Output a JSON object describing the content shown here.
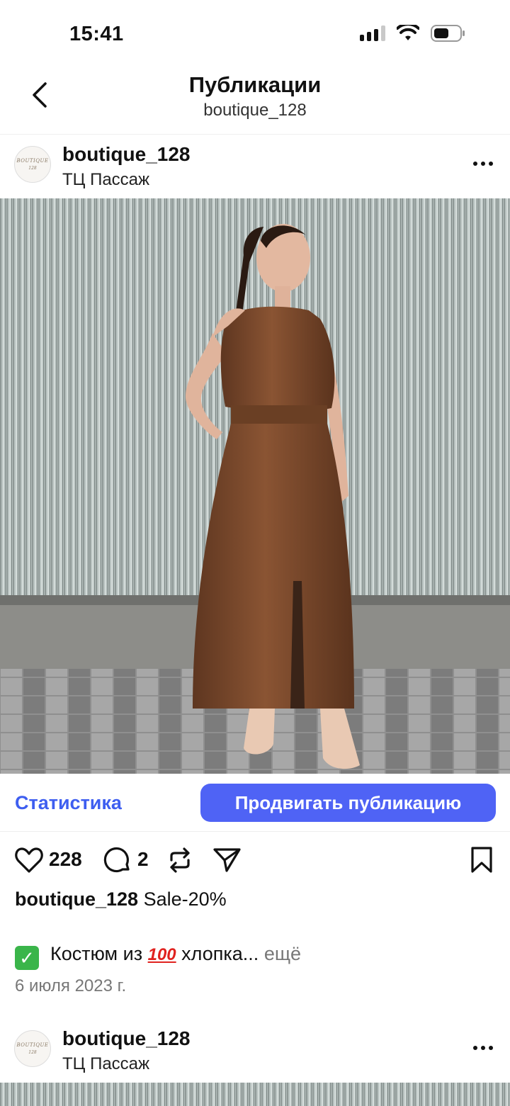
{
  "status": {
    "time": "15:41"
  },
  "nav": {
    "title": "Публикации",
    "subtitle": "boutique_128"
  },
  "post": {
    "username": "boutique_128",
    "location": "ТЦ  Пассаж",
    "avatar_line1": "BOUTIQUE",
    "avatar_line2": "128",
    "actions": {
      "stats_label": "Статистика",
      "promote_label": "Продвигать публикацию"
    },
    "likes": "228",
    "comments": "2",
    "caption_user": "boutique_128",
    "caption_text": "Sale-20%",
    "desc_check": "✓",
    "desc_text1": "Костюм  из",
    "desc_emoji": "100",
    "desc_text2": "хлопка...",
    "desc_more": "ещё",
    "date": "6 июля 2023 г."
  },
  "next_post": {
    "username": "boutique_128",
    "location": "ТЦ  Пассаж",
    "avatar_line1": "BOUTIQUE",
    "avatar_line2": "128"
  },
  "colors": {
    "accent": "#4f63f5",
    "link": "#3e5ef0",
    "dress": "#7a4a2c",
    "wall": "#b9c3c1"
  },
  "icons": [
    "back-chevron-icon",
    "signal-icon",
    "wifi-icon",
    "battery-icon",
    "more-icon",
    "heart-icon",
    "comment-icon",
    "repost-icon",
    "share-icon",
    "bookmark-icon"
  ]
}
